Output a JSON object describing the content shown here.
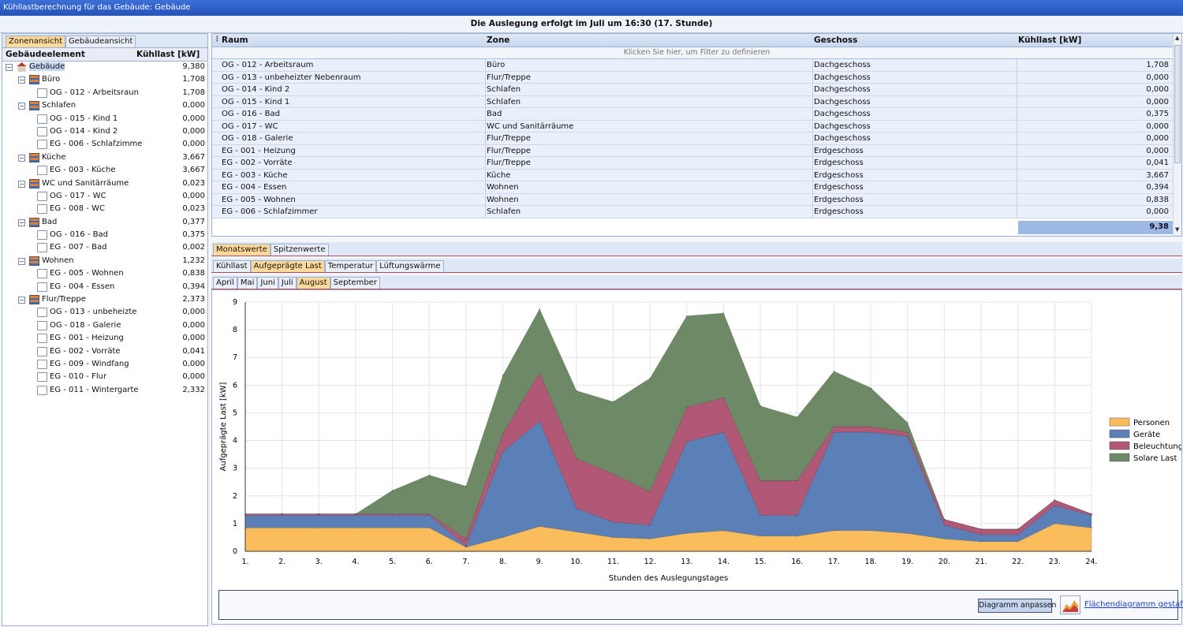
{
  "window": {
    "title": "Kühllastberechnung für das Gebäude: Gebäude",
    "subtitle": "Die Auslegung erfolgt im Juli um 16:30 (17. Stunde)"
  },
  "left_panel": {
    "tabs": [
      "Zonenansicht",
      "Gebäudeansicht"
    ],
    "active_tab": "Zonenansicht",
    "col_element": "Gebäudeelement",
    "col_load": "Kühllast [kW]",
    "tree": [
      {
        "label": "Gebäude",
        "value": "9,380",
        "level": 0,
        "kind": "house"
      },
      {
        "label": "Büro",
        "value": "1,708",
        "level": 1,
        "kind": "zone"
      },
      {
        "label": "OG - 012 - Arbeitsraun",
        "value": "1,708",
        "level": 2,
        "kind": "room"
      },
      {
        "label": "Schlafen",
        "value": "0,000",
        "level": 1,
        "kind": "zone"
      },
      {
        "label": "OG - 015 - Kind 1",
        "value": "0,000",
        "level": 2,
        "kind": "room"
      },
      {
        "label": "OG - 014 - Kind 2",
        "value": "0,000",
        "level": 2,
        "kind": "room"
      },
      {
        "label": "EG - 006 - Schlafzimme",
        "value": "0,000",
        "level": 2,
        "kind": "room"
      },
      {
        "label": "Küche",
        "value": "3,667",
        "level": 1,
        "kind": "zone"
      },
      {
        "label": "EG - 003 - Küche",
        "value": "3,667",
        "level": 2,
        "kind": "room"
      },
      {
        "label": "WC und Sanitärräume",
        "value": "0,023",
        "level": 1,
        "kind": "zone"
      },
      {
        "label": "OG - 017 - WC",
        "value": "0,000",
        "level": 2,
        "kind": "room"
      },
      {
        "label": "EG - 008 - WC",
        "value": "0,023",
        "level": 2,
        "kind": "room"
      },
      {
        "label": "Bad",
        "value": "0,377",
        "level": 1,
        "kind": "zone"
      },
      {
        "label": "OG - 016 - Bad",
        "value": "0,375",
        "level": 2,
        "kind": "room"
      },
      {
        "label": "EG - 007 - Bad",
        "value": "0,002",
        "level": 2,
        "kind": "room"
      },
      {
        "label": "Wohnen",
        "value": "1,232",
        "level": 1,
        "kind": "zone"
      },
      {
        "label": "EG - 005 - Wohnen",
        "value": "0,838",
        "level": 2,
        "kind": "room"
      },
      {
        "label": "EG - 004 - Essen",
        "value": "0,394",
        "level": 2,
        "kind": "room"
      },
      {
        "label": "Flur/Treppe",
        "value": "2,373",
        "level": 1,
        "kind": "zone"
      },
      {
        "label": "OG - 013 - unbeheizte",
        "value": "0,000",
        "level": 2,
        "kind": "room"
      },
      {
        "label": "OG - 018 - Galerie",
        "value": "0,000",
        "level": 2,
        "kind": "room"
      },
      {
        "label": "EG - 001 - Heizung",
        "value": "0,000",
        "level": 2,
        "kind": "room"
      },
      {
        "label": "EG - 002 - Vorräte",
        "value": "0,041",
        "level": 2,
        "kind": "room"
      },
      {
        "label": "EG - 009 - Windfang",
        "value": "0,000",
        "level": 2,
        "kind": "room"
      },
      {
        "label": "EG - 010 - Flur",
        "value": "0,000",
        "level": 2,
        "kind": "room"
      },
      {
        "label": "EG - 011 - Wintergarte",
        "value": "2,332",
        "level": 2,
        "kind": "room"
      }
    ]
  },
  "grid": {
    "columns": [
      "Raum",
      "Zone",
      "Geschoss",
      "Kühllast [kW]"
    ],
    "filter_hint": "Klicken Sie hier, um Filter zu definieren",
    "rows": [
      [
        "OG - 012 - Arbeitsraum",
        "Büro",
        "Dachgeschoss",
        "1,708"
      ],
      [
        "OG - 013 - unbeheizter Nebenraum",
        "Flur/Treppe",
        "Dachgeschoss",
        "0,000"
      ],
      [
        "OG - 014 - Kind 2",
        "Schlafen",
        "Dachgeschoss",
        "0,000"
      ],
      [
        "OG - 015 - Kind 1",
        "Schlafen",
        "Dachgeschoss",
        "0,000"
      ],
      [
        "OG - 016 - Bad",
        "Bad",
        "Dachgeschoss",
        "0,375"
      ],
      [
        "OG - 017 - WC",
        "WC und Sanitärräume",
        "Dachgeschoss",
        "0,000"
      ],
      [
        "OG - 018 - Galerie",
        "Flur/Treppe",
        "Dachgeschoss",
        "0,000"
      ],
      [
        "EG - 001 - Heizung",
        "Flur/Treppe",
        "Erdgeschoss",
        "0,000"
      ],
      [
        "EG - 002 - Vorräte",
        "Flur/Treppe",
        "Erdgeschoss",
        "0,041"
      ],
      [
        "EG - 003 - Küche",
        "Küche",
        "Erdgeschoss",
        "3,667"
      ],
      [
        "EG - 004 - Essen",
        "Wohnen",
        "Erdgeschoss",
        "0,394"
      ],
      [
        "EG - 005 - Wohnen",
        "Wohnen",
        "Erdgeschoss",
        "0,838"
      ],
      [
        "EG - 006 - Schlafzimmer",
        "Schlafen",
        "Erdgeschoss",
        "0,000"
      ]
    ],
    "total": "9,38"
  },
  "tabs_view": [
    "Monatswerte",
    "Spitzenwerte"
  ],
  "tabs_view_active": "Monatswerte",
  "tabs_load": [
    "Kühllast",
    "Aufgeprägte Last",
    "Temperatur",
    "Lüftungswärme"
  ],
  "tabs_load_active": "Aufgeprägte Last",
  "tabs_month": [
    "April",
    "Mai",
    "Juni",
    "Juli",
    "August",
    "September"
  ],
  "tabs_month_active": "August",
  "footer": {
    "adjust_button": "Diagramm anpassen",
    "stacked_link": "Flächendiagramm gestaffelt"
  },
  "chart_data": {
    "type": "area",
    "stacked": true,
    "xlabel": "Stunden des Auslegungstages",
    "ylabel": "Aufgeprägte Last [kW]",
    "ylim": [
      0,
      9
    ],
    "yticks": [
      0,
      1,
      2,
      3,
      4,
      5,
      6,
      7,
      8,
      9
    ],
    "categories": [
      "1.",
      "2.",
      "3.",
      "4.",
      "5.",
      "6.",
      "7.",
      "8.",
      "9.",
      "10.",
      "11.",
      "12.",
      "13.",
      "14.",
      "15.",
      "16.",
      "17.",
      "18.",
      "19.",
      "20.",
      "21.",
      "22.",
      "23.",
      "24."
    ],
    "grid": true,
    "legend_position": "right",
    "series": [
      {
        "name": "Personen",
        "color": "#fbbd5c",
        "values": [
          0.85,
          0.85,
          0.85,
          0.85,
          0.85,
          0.85,
          0.15,
          0.5,
          0.9,
          0.7,
          0.5,
          0.45,
          0.65,
          0.75,
          0.55,
          0.55,
          0.75,
          0.75,
          0.65,
          0.45,
          0.35,
          0.35,
          1.0,
          0.85
        ]
      },
      {
        "name": "Geräte",
        "color": "#5b80b8",
        "values": [
          0.45,
          0.45,
          0.45,
          0.45,
          0.45,
          0.45,
          0.05,
          3.1,
          3.8,
          0.85,
          0.55,
          0.5,
          3.3,
          3.55,
          0.75,
          0.75,
          3.55,
          3.55,
          3.5,
          0.5,
          0.25,
          0.25,
          0.65,
          0.45
        ]
      },
      {
        "name": "Beleuchtung",
        "color": "#b05876",
        "values": [
          0.05,
          0.05,
          0.05,
          0.05,
          0.05,
          0.05,
          0.25,
          0.65,
          1.75,
          1.8,
          1.75,
          1.2,
          1.25,
          1.25,
          1.25,
          1.25,
          0.2,
          0.2,
          0.15,
          0.2,
          0.2,
          0.2,
          0.2,
          0.05
        ]
      },
      {
        "name": "Solare Last",
        "color": "#6e8966",
        "values": [
          0,
          0,
          0,
          0,
          0.85,
          1.4,
          1.9,
          2.1,
          2.3,
          2.45,
          2.6,
          4.1,
          3.3,
          3.05,
          2.7,
          2.3,
          2.0,
          1.4,
          0.35,
          0,
          0,
          0,
          0,
          0
        ]
      }
    ]
  }
}
